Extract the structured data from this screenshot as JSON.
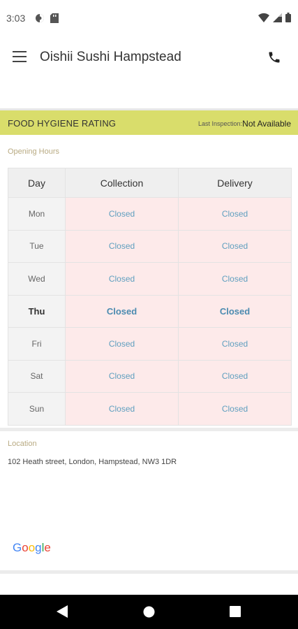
{
  "status_bar": {
    "time": "3:03"
  },
  "app_bar": {
    "title": "Oishii Sushi Hampstead"
  },
  "hygiene": {
    "title": "FOOD HYGIENE RATING",
    "last_inspection_label": "Last Inspection:",
    "last_inspection_value": "Not Available",
    "color": "#d9dd6b"
  },
  "opening_hours": {
    "label": "Opening Hours",
    "headers": [
      "Day",
      "Collection",
      "Delivery"
    ],
    "rows": [
      {
        "day": "Mon",
        "collection": "Closed",
        "delivery": "Closed"
      },
      {
        "day": "Tue",
        "collection": "Closed",
        "delivery": "Closed"
      },
      {
        "day": "Wed",
        "collection": "Closed",
        "delivery": "Closed"
      },
      {
        "day": "Thu",
        "collection": "Closed",
        "delivery": "Closed"
      },
      {
        "day": "Fri",
        "collection": "Closed",
        "delivery": "Closed"
      },
      {
        "day": "Sat",
        "collection": "Closed",
        "delivery": "Closed"
      },
      {
        "day": "Sun",
        "collection": "Closed",
        "delivery": "Closed"
      }
    ],
    "today": "Thu"
  },
  "location": {
    "label": "Location",
    "address": "102 Heath street, London, Hampstead, NW3 1DR"
  },
  "map": {
    "attribution": "Google"
  }
}
